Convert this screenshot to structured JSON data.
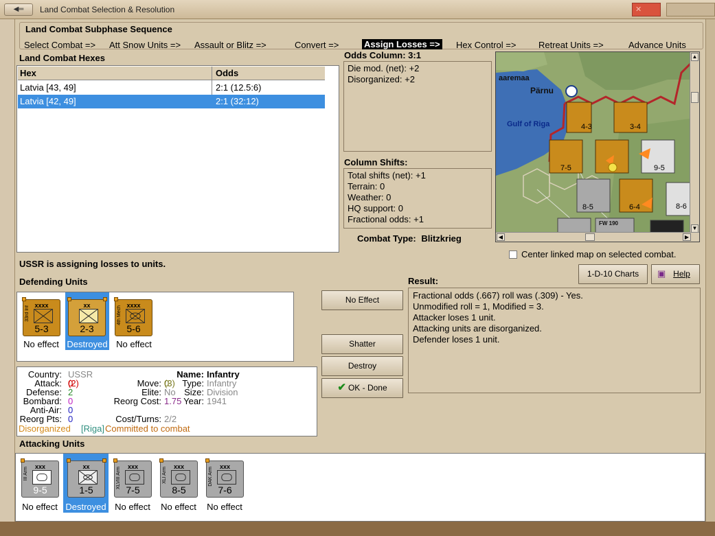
{
  "window": {
    "title": "Land Combat Selection & Resolution",
    "close_glyph": "✕"
  },
  "sequence": {
    "label": "Land Combat Subphase Sequence",
    "steps": [
      "Select Combat =>",
      "Att Snow Units =>",
      "Assault or Blitz =>",
      "Convert =>",
      "Assign Losses =>",
      "Hex Control =>",
      "Retreat Units =>",
      "Advance Units"
    ],
    "active_index": 4
  },
  "hexes": {
    "label": "Land Combat Hexes",
    "col_hex": "Hex",
    "col_odds": "Odds",
    "rows": [
      {
        "hex": "Latvia [43, 49]",
        "odds": "2:1 (12.5:6)"
      },
      {
        "hex": "Latvia [42, 49]",
        "odds": "2:1 (32:12)",
        "selected": true
      }
    ]
  },
  "odds": {
    "label": "Odds Column: 3:1",
    "lines": [
      "Die mod. (net): +2",
      "Disorganized: +2"
    ]
  },
  "shifts": {
    "label": "Column Shifts:",
    "lines": [
      "Total shifts (net): +1",
      "Terrain: 0",
      "Weather: 0",
      "HQ support: 0",
      "Fractional odds: +1"
    ]
  },
  "combat_type": {
    "label": "Combat Type:",
    "value": "Blitzkrieg"
  },
  "map": {
    "labels": [
      "aaremaa",
      "Pärnu",
      "Gulf of Riga",
      "FW 190"
    ]
  },
  "center_map": {
    "label": "Center linked map on selected combat.",
    "checked": false
  },
  "charts_button": "1-D-10 Charts",
  "help_button": "Help",
  "status": "USSR is assigning losses to units.",
  "defending": {
    "label": "Defending Units",
    "units": [
      {
        "name": "33rd Inf",
        "size": "xxxx",
        "strength": "5-3",
        "status": "No effect",
        "color": "gold"
      },
      {
        "name": "",
        "size": "xx",
        "strength": "2-3",
        "status": "Destroyed",
        "color": "gold",
        "selected": true
      },
      {
        "name": "4th Mech",
        "size": "xxxx",
        "strength": "5-6",
        "status": "No effect",
        "color": "gold"
      }
    ]
  },
  "buttons": {
    "no_effect": "No Effect",
    "shatter": "Shatter",
    "destroy": "Destroy",
    "ok": "OK - Done"
  },
  "result": {
    "label": "Result:",
    "lines": [
      "Fractional odds (.667) roll was (.309)  - Yes.",
      "Unmodified roll = 1, Modified = 3.",
      "Attacker loses 1 unit.",
      "Attacking units are disorganized.",
      "Defender loses 1 unit."
    ]
  },
  "info": {
    "country_label": "Country:",
    "country": "USSR",
    "attack_label": "Attack:",
    "attack": "0",
    "attack_paren": "(2)",
    "defense_label": "Defense:",
    "defense": "2",
    "bombard_label": "Bombard:",
    "bombard": "0",
    "antiair_label": "Anti-Air:",
    "antiair": "0",
    "reorg_pts_label": "Reorg Pts:",
    "reorg_pts": "0",
    "name_label": "Name:",
    "name": "Infantry",
    "move_label": "Move:",
    "move": "0",
    "move_paren": "(3)",
    "type_label": "Type:",
    "type": "Infantry",
    "elite_label": "Elite:",
    "elite": "No",
    "size_label": "Size:",
    "size": "Division",
    "reorg_cost_label": "Reorg Cost:",
    "reorg_cost": "1.75",
    "year_label": "Year:",
    "year": "1941",
    "cost_turns_label": "Cost/Turns:",
    "cost_turns": "2/2",
    "disorganized": "Disorganized",
    "hq": "[Riga]",
    "committed": "Committed to combat"
  },
  "attacking": {
    "label": "Attacking Units",
    "units": [
      {
        "name": "III Arm",
        "size": "xxx",
        "strength": "9-5",
        "status": "No effect",
        "color": "grey",
        "sym": "armor"
      },
      {
        "name": "",
        "size": "xx",
        "strength": "1-5",
        "status": "Destroyed",
        "color": "grey",
        "sym": "mech",
        "selected": true
      },
      {
        "name": "XLVIII Arm",
        "size": "xxx",
        "strength": "7-5",
        "status": "No effect",
        "color": "grey",
        "sym": "armor"
      },
      {
        "name": "XLI Arm",
        "size": "xxx",
        "strength": "8-5",
        "status": "No effect",
        "color": "grey",
        "sym": "armor"
      },
      {
        "name": "DAK Arm",
        "size": "xxx",
        "strength": "7-6",
        "status": "No effect",
        "color": "grey",
        "sym": "armor"
      }
    ]
  },
  "colors": {
    "gold": "#c98b1c",
    "grey": "#a9a9a9",
    "selected": "#3d8fe0",
    "active_step": "#000000",
    "red": "#d00000",
    "green": "#2b8a2b",
    "purple": "#8a2b8a",
    "gray_text": "#888888",
    "teal": "#2f8f7f",
    "orange": "#d48a1a",
    "orange2": "#c06a10"
  }
}
